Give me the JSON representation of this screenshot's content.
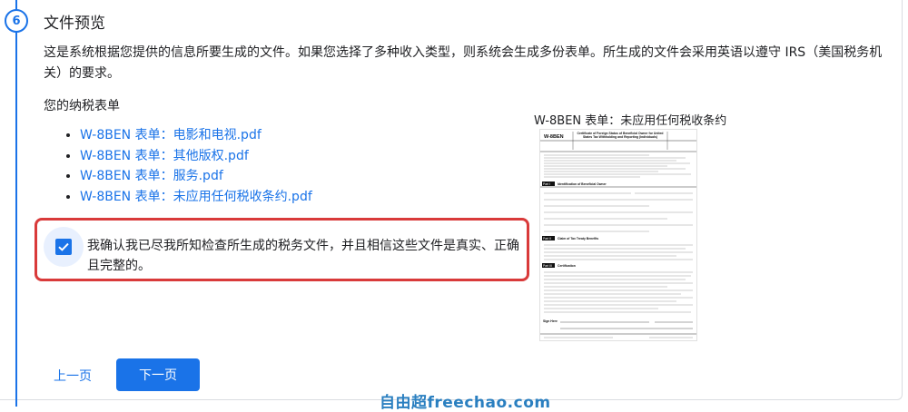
{
  "step": {
    "number": "6",
    "title": "文件预览",
    "description": "这是系统根据您提供的信息所要生成的文件。如果您选择了多种收入类型，则系统会生成多份表单。所生成的文件会采用英语以遵守 IRS（美国税务机关）的要求。"
  },
  "forms": {
    "heading": "您的纳税表单",
    "items": [
      {
        "label": "W-8BEN 表单：电影和电视.pdf"
      },
      {
        "label": "W-8BEN 表单：其他版权.pdf"
      },
      {
        "label": "W-8BEN 表单：服务.pdf"
      },
      {
        "label": "W-8BEN 表单：未应用任何税收条约.pdf"
      }
    ]
  },
  "confirmation": {
    "checked": true,
    "text": "我确认我已尽我所知检查所生成的税务文件，并且相信这些文件是真实、正确且完整的。"
  },
  "preview": {
    "label": "W-8BEN 表单：未应用任何税收条约",
    "doc_header": "W-8BEN",
    "doc_title": "Certificate of Foreign Status of Beneficial Owner for United States Tax Withholding and Reporting (Individuals)",
    "part_labels": [
      "Part I",
      "Part II",
      "Part III"
    ],
    "part_titles": [
      "Identification of Beneficial Owner",
      "Claim of Tax Treaty Benefits",
      "Certification"
    ],
    "sign_here": "Sign Here"
  },
  "navigation": {
    "back_label": "上一页",
    "next_label": "下一页"
  },
  "watermark": "自由超freechao.com",
  "colors": {
    "accent": "#1a73e8",
    "highlight_border": "#d93a3a"
  }
}
